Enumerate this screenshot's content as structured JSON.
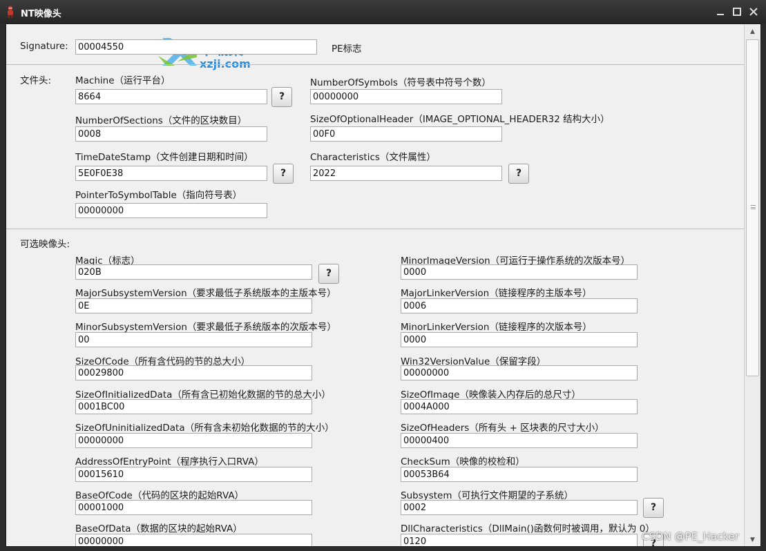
{
  "window": {
    "title": "NT映像头",
    "minimize_icon": "minimize-icon",
    "maximize_icon": "maximize-icon",
    "close_icon": "close-icon"
  },
  "watermark": {
    "line1": "下载集",
    "line2": "xzji.com"
  },
  "signature": {
    "label": "Signature:",
    "value": "00004550",
    "note": "PE标志"
  },
  "file_header": {
    "section_label": "文件头:",
    "machine": {
      "label": "Machine（运行平台）",
      "value": "8664"
    },
    "number_of_symbols": {
      "label": "NumberOfSymbols（符号表中符号个数）",
      "value": "00000000"
    },
    "number_of_sections": {
      "label": "NumberOfSections（文件的区块数目）",
      "value": "0008"
    },
    "size_of_optional_header": {
      "label": "SizeOfOptionalHeader（IMAGE_OPTIONAL_HEADER32 结构大小）",
      "value": "00F0"
    },
    "time_date_stamp": {
      "label": "TimeDateStamp（文件创建日期和时间）",
      "value": "5E0F0E38"
    },
    "characteristics": {
      "label": "Characteristics（文件属性）",
      "value": "2022"
    },
    "pointer_to_symbol_table": {
      "label": "PointerToSymbolTable（指向符号表）",
      "value": "00000000"
    }
  },
  "optional_header": {
    "section_label": "可选映像头:",
    "magic": {
      "label": "Magic（标志）",
      "value": "020B"
    },
    "minor_image_version": {
      "label": "MinorImageVersion（可运行于操作系统的次版本号）",
      "value": "0000"
    },
    "major_subsystem_version": {
      "label": "MajorSubsystemVersion（要求最低子系统版本的主版本号）",
      "value": "0E"
    },
    "major_linker_version": {
      "label": "MajorLinkerVersion（链接程序的主版本号）",
      "value": "0006"
    },
    "minor_subsystem_version": {
      "label": "MinorSubsystemVersion（要求最低子系统版本的次版本号）",
      "value": "00"
    },
    "minor_linker_version": {
      "label": "MinorLinkerVersion（链接程序的次版本号）",
      "value": "0000"
    },
    "size_of_code": {
      "label": "SizeOfCode（所有含代码的节的总大小）",
      "value": "00029800"
    },
    "win32_version_value": {
      "label": "Win32VersionValue（保留字段）",
      "value": "00000000"
    },
    "size_of_initialized_data": {
      "label": "SizeOfInitializedData（所有含已初始化数据的节的总大小）",
      "value": "0001BC00"
    },
    "size_of_image": {
      "label": "SizeOfImage（映像装入内存后的总尺寸）",
      "value": "0004A000"
    },
    "size_of_uninitialized_data": {
      "label": "SizeOfUninitializedData（所有含未初始化数据的节的大小）",
      "value": "00000000"
    },
    "size_of_headers": {
      "label": "SizeOfHeaders（所有头 + 区块表的尺寸大小）",
      "value": "00000400"
    },
    "address_of_entry_point": {
      "label": "AddressOfEntryPoint（程序执行入口RVA）",
      "value": "00015610"
    },
    "check_sum": {
      "label": "CheckSum（映像的校检和）",
      "value": "00053B64"
    },
    "base_of_code": {
      "label": "BaseOfCode（代码的区块的起始RVA）",
      "value": "00001000"
    },
    "subsystem": {
      "label": "Subsystem（可执行文件期望的子系统）",
      "value": "0002"
    },
    "base_of_data": {
      "label": "BaseOfData（数据的区块的起始RVA）",
      "value": "00000000"
    },
    "dll_characteristics": {
      "label": "DllCharacteristics（DllMain()函数何时被调用，默认为 0）",
      "value": "0120"
    }
  },
  "help_button_label": "?",
  "credit": "CSDN @PE_Hacker"
}
